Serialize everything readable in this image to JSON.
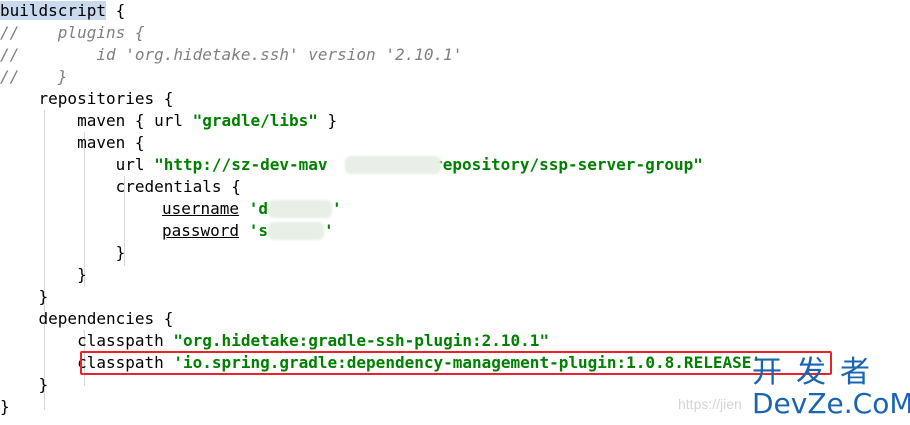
{
  "code": {
    "l1_kw": "buildscript",
    "l1_rest": " {",
    "l2": "//    plugins {",
    "l3": "//        id 'org.hidetake.ssh' version '2.10.1'",
    "l4": "//    }",
    "l5": "    repositories {",
    "l6_a": "        maven { url ",
    "l6_str": "\"gradle/libs\"",
    "l6_b": " }",
    "l7": "        maven {",
    "l8_a": "            url ",
    "l8_str1": "\"http://sz-dev-mav",
    "l8_str2": "/repository/ssp-server-group\"",
    "l9": "            credentials {",
    "l10_key": "username",
    "l10_str1": " 'd",
    "l10_str2": "'",
    "l11_key": "password",
    "l11_str1": " 's",
    "l11_str2": "'",
    "l12": "            }",
    "l13": "        }",
    "l14": "    }",
    "l15": "    dependencies {",
    "l16_a": "        classpath ",
    "l16_str": "\"org.hidetake:gradle-ssh-plugin:2.10.1\"",
    "l17_a": "        classpath ",
    "l17_str": "'io.spring.gradle:dependency-management-plugin:1.0.8.RELEASE'",
    "l18": "    }",
    "l19": "}"
  },
  "watermark": {
    "url_text": "https://jien",
    "logo_cn": "开发者",
    "logo_en": "DevZe.CoM"
  },
  "colors": {
    "highlight_box": "#e8232b",
    "string_green": "#008000",
    "comment_gray": "#808080",
    "selection": "#c9d9ee",
    "logo_blue": "#1a64b4"
  }
}
